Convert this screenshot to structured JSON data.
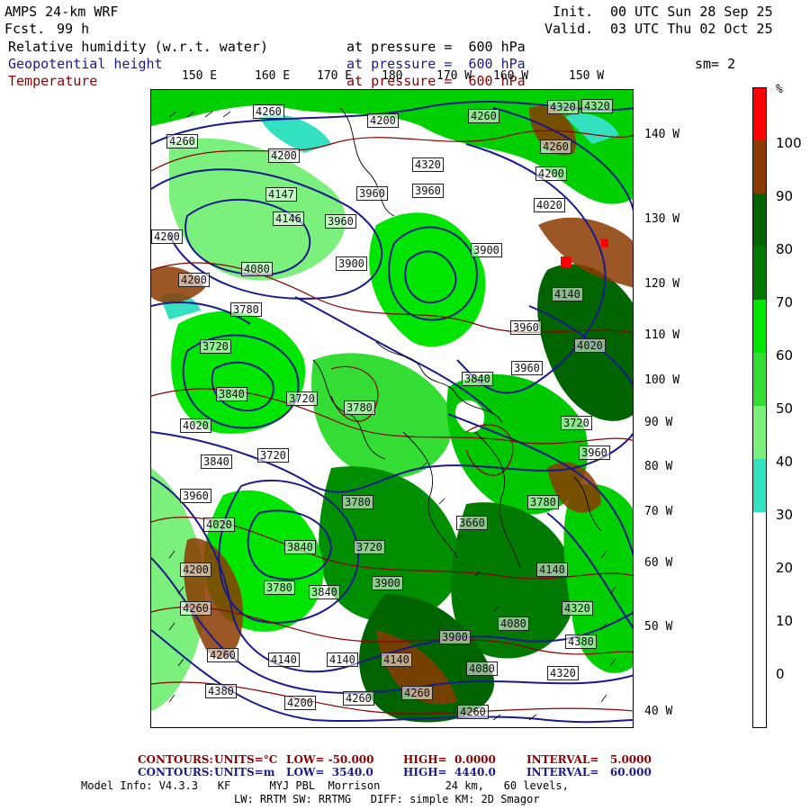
{
  "header": {
    "model": "AMPS 24-km WRF",
    "fcst_label": "Fcst.",
    "fcst_value": "99 h",
    "init_label": "Init.",
    "init_value": "00 UTC Sun 28 Sep 25",
    "valid_label": "Valid.",
    "valid_value": "03 UTC Thu 02 Oct 25",
    "fields": [
      {
        "name": "Relative humidity (w.r.t. water)",
        "level": "at pressure =  600 hPa",
        "color": "#000000"
      },
      {
        "name": "Geopotential height",
        "level": "at pressure =  600 hPa",
        "color": "#1a1a8c"
      },
      {
        "name": "Temperature",
        "level": "at pressure =  600 hPa",
        "color": "#8b0000"
      }
    ],
    "smoothing": "sm= 2"
  },
  "map": {
    "lon_labels": [
      "150 E",
      "160 E",
      "170 E",
      "180",
      "170 W",
      "160 W",
      "150 W"
    ],
    "lat_side_labels": [
      "140 W",
      "130 W",
      "120 W",
      "110 W",
      "100 W",
      "90 W",
      "80 W",
      "70 W",
      "60 W",
      "50 W",
      "40 W"
    ],
    "height_labels": [
      "4260",
      "4200",
      "4260",
      "4320",
      "4260",
      "4200",
      "4320",
      "4260",
      "4200",
      "4200",
      "4147",
      "4146",
      "3960",
      "3960",
      "4080",
      "3900",
      "4200",
      "4020",
      "3960",
      "3900",
      "3780",
      "3960",
      "4140",
      "3720",
      "3840",
      "4020",
      "3720",
      "3960",
      "3780",
      "3840",
      "3720",
      "4020",
      "3960",
      "3780",
      "3840",
      "3660",
      "3720",
      "3780",
      "3960",
      "4020",
      "3840",
      "3720",
      "3780",
      "3840",
      "3900",
      "4200",
      "4140",
      "4260",
      "3900",
      "4320",
      "4080",
      "4260",
      "4380",
      "4140",
      "4140",
      "4140",
      "4080",
      "4320",
      "4380",
      "4200",
      "4260",
      "4260",
      "4260",
      "4320"
    ]
  },
  "colorbar": {
    "unit": "%",
    "labels": [
      "100",
      "90",
      "80",
      "70",
      "60",
      "50",
      "40",
      "30",
      "20",
      "10",
      "0"
    ],
    "colors": {
      "rh_90_100": "#ff0000",
      "rh_80_90": "#8b3a00",
      "rh_70_80": "#006400",
      "rh_60_70": "#007a00",
      "rh_50_60": "#00e600",
      "rh_40_50": "#33dd33",
      "rh_30_40": "#7cf07c",
      "rh_20_30": "#33e0c0",
      "rh_below": "#ffffff"
    }
  },
  "contours": [
    {
      "label": "CONTOURS:",
      "units": "UNITS=°C",
      "low": "LOW= -50.000",
      "high": "HIGH=  0.0000",
      "interval": "INTERVAL=   5.0000",
      "color": "#8b0000"
    },
    {
      "label": "CONTOURS:",
      "units": "UNITS=m",
      "low": "LOW=  3540.0",
      "high": "HIGH=  4440.0",
      "interval": "INTERVAL=   60.000",
      "color": "#1a1a8c"
    }
  ],
  "footer": {
    "line1": "Model Info: V4.3.3   KF      MYJ PBL  Morrison          24 km,   60 levels,",
    "line2": "LW: RRTM SW: RRTMG   DIFF: simple KM: 2D Smagor"
  }
}
